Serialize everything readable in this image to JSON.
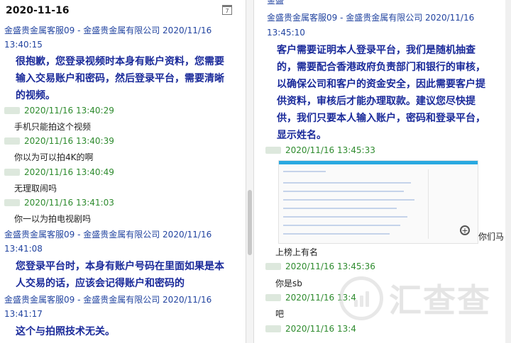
{
  "left": {
    "date_header": "2020-11-16",
    "calendar_icon_text": "7",
    "messages": [
      {
        "sender": "金盛贵金属客服09 - 金盛贵金属有限公司 2020/11/16",
        "time": "13:40:15",
        "lines": [
          "很抱歉，您登录视频时本身有账户资料，您需要",
          "输入交易账户和密码，然后登录平台，需要清晰",
          "的视频。"
        ]
      },
      {
        "user_time": "2020/11/16 13:40:29",
        "text": "手机只能拍这个视频"
      },
      {
        "user_time": "2020/11/16 13:40:39",
        "text": "你以为可以拍4K的啊"
      },
      {
        "user_time": "2020/11/16 13:40:49",
        "text": "无理取闹吗"
      },
      {
        "user_time": "2020/11/16 13:41:03",
        "text": "你一以为拍电视剧吗"
      },
      {
        "sender": "金盛贵金属客服09 - 金盛贵金属有限公司 2020/11/16",
        "time": "13:41:08",
        "lines": [
          "您登录平台时，本身有账户号码在里面如果是本",
          "人交易的话，应该会记得账户和密码的"
        ]
      },
      {
        "sender": "金盛贵金属客服09 - 金盛贵金属有限公司 2020/11/16",
        "time": "13:41:17",
        "lines": [
          "这个与拍照技术无关。"
        ]
      }
    ]
  },
  "right": {
    "top_cut_text": "金盛",
    "messages": [
      {
        "sender": "金盛贵金属客服09 - 金盛贵金属有限公司 2020/11/16",
        "time": "13:45:10",
        "lines": [
          "客户需要证明本人登录平台，我们是随机抽查",
          "的，需要配合香港政府负责部门和银行的审核，",
          "以确保公司和客户的资金安全，因此需要客户提",
          "供资料，审核后才能办理取款。建议您尽快提",
          "供，我们只要本人输入账户，密码和登录平台，",
          "显示姓名。"
        ]
      },
      {
        "user_time": "2020/11/16 13:45:33"
      },
      {
        "text": "上榜上有名"
      },
      {
        "user_time": "2020/11/16 13:45:36",
        "text": "你是sb"
      },
      {
        "user_time": "2020/11/16 13:4",
        "text": "吧"
      },
      {
        "user_time": "2020/11/16 13:4"
      }
    ],
    "image_caption": "你们马",
    "watermark_text": "汇查查"
  }
}
